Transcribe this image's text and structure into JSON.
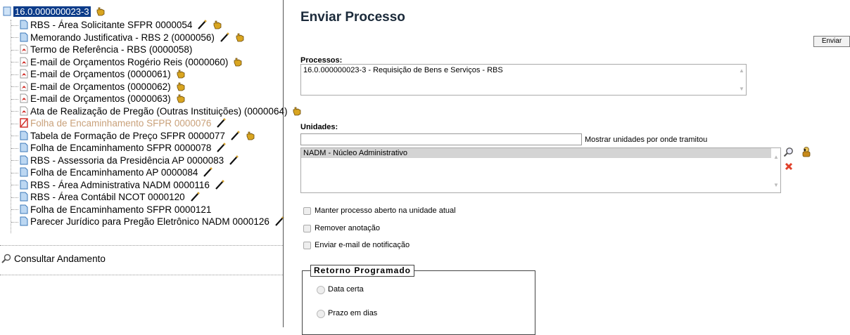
{
  "tree": {
    "root_label": "16.0.000000023-3",
    "items": [
      {
        "label": "RBS - Área Solicitante SFPR 0000054",
        "icon": "doc-blue",
        "pen": true,
        "hand": true
      },
      {
        "label": "Memorando Justificativa - RBS 2 (0000056)",
        "icon": "doc-blue",
        "pen": true,
        "hand": true
      },
      {
        "label": "Termo de Referência - RBS (0000058)",
        "icon": "pdf",
        "pen": false,
        "hand": false
      },
      {
        "label": "E-mail de Orçamentos Rogério Reis (0000060)",
        "icon": "pdf",
        "pen": false,
        "hand": true
      },
      {
        "label": "E-mail de Orçamentos (0000061)",
        "icon": "pdf",
        "pen": false,
        "hand": true
      },
      {
        "label": "E-mail de Orçamentos (0000062)",
        "icon": "pdf",
        "pen": false,
        "hand": true
      },
      {
        "label": "E-mail de Orçamentos (0000063)",
        "icon": "pdf",
        "pen": false,
        "hand": true
      },
      {
        "label": "Ata de Realização de Pregão (Outras Instituições) (0000064)",
        "icon": "pdf",
        "pen": false,
        "hand": true
      },
      {
        "label": "Folha de Encaminhamento SFPR 0000076",
        "icon": "cancelled",
        "pen": true,
        "hand": false
      },
      {
        "label": "Tabela de Formação de Preço SFPR 0000077",
        "icon": "doc-blue",
        "pen": true,
        "hand": true
      },
      {
        "label": "Folha de Encaminhamento SFPR 0000078",
        "icon": "doc-blue",
        "pen": true,
        "hand": false
      },
      {
        "label": "RBS - Assessoria da Presidência AP 0000083",
        "icon": "doc-blue",
        "pen": true,
        "hand": false
      },
      {
        "label": "Folha de Encaminhamento AP 0000084",
        "icon": "doc-blue",
        "pen": true,
        "hand": false
      },
      {
        "label": "RBS - Área Administrativa NADM 0000116",
        "icon": "doc-blue",
        "pen": true,
        "hand": false
      },
      {
        "label": "RBS - Área Contábil NCOT 0000120",
        "icon": "doc-blue",
        "pen": true,
        "hand": false
      },
      {
        "label": "Folha de Encaminhamento SFPR 0000121",
        "icon": "doc-blue",
        "pen": false,
        "hand": false
      },
      {
        "label": "Parecer Jurídico para Pregão Eletrônico NADM 0000126",
        "icon": "doc-blue",
        "pen": true,
        "hand": false
      }
    ],
    "consultar": "Consultar Andamento"
  },
  "form": {
    "title": "Enviar Processo",
    "enviar_button": "Enviar",
    "processos_label": "Processos:",
    "processos_value": "16.0.000000023-3 - Requisição de Bens e Serviços - RBS",
    "unidades_label": "Unidades:",
    "unidades_input": "",
    "mostrar_link": "Mostrar unidades por onde tramitou",
    "unidades_selected": "NADM - Núcleo Administrativo",
    "checkboxes": [
      "Manter processo aberto na unidade atual",
      "Remover anotação",
      "Enviar e-mail de notificação"
    ],
    "retorno_legend": "Retorno Programado",
    "radios": [
      "Data certa",
      "Prazo em dias"
    ]
  }
}
